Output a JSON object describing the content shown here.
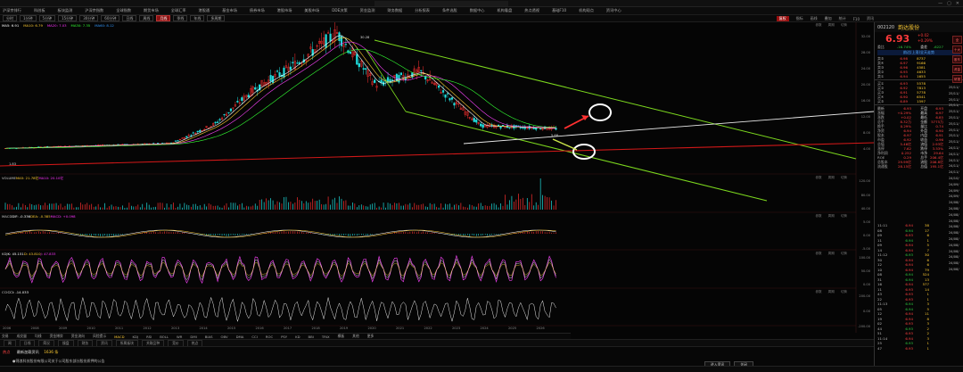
{
  "window": {
    "title_text": "",
    "controls": [
      "—",
      "▢",
      "✕"
    ]
  },
  "menu": {
    "items": [
      "沪深京排行",
      "科创板",
      "板块监测",
      "沪深京指数",
      "全球指数",
      "期货市场",
      "全球汇率",
      "港股通",
      "基金市场",
      "债券市场",
      "港股市场",
      "美股市场",
      "DDE决策",
      "资金监测",
      "财务数据",
      "分析报表",
      "条件选股",
      "数据中心",
      "机构看盘",
      "热点透视",
      "基础F10",
      "机构观点",
      "资讯中心"
    ]
  },
  "toolbar": {
    "periods": [
      "分时",
      "1分钟",
      "5分钟",
      "15分钟",
      "30分钟",
      "60分钟",
      "日线",
      "周线",
      "月线",
      "季线",
      "年线",
      "多周期"
    ],
    "active_period": "月线",
    "right_tools": [
      "复权",
      "指标",
      "画线",
      "叠加",
      "统计",
      "F10",
      "资讯"
    ]
  },
  "chart": {
    "main_legend": [
      "MA5: 6.91",
      "MA10: 6.79",
      "MA20: 7.03",
      "MA30: 7.35",
      "MA60: 8.12"
    ],
    "main_title": "",
    "y_ticks": [
      "32.00",
      "28.00",
      "24.00",
      "20.00",
      "16.00",
      "12.00",
      "8.00",
      "4.00"
    ],
    "peak_label": "30.28",
    "low_label": "1.83",
    "last_label": "5.68",
    "volume_legend": [
      "VOLUME",
      "MA5: 21.78亿",
      "MA10: 20.10亿"
    ],
    "volume_y": [
      "120.00",
      "80.00",
      "40.00"
    ],
    "macd_legend": [
      "MACD",
      "DIF: -0.336",
      "DEA: -0.385",
      "MACD: +0.098"
    ],
    "macd_y": [
      "5.00",
      "0.00",
      "-5.00"
    ],
    "kdj_legend": [
      "KDJ",
      "K: 45.151",
      "D: 43.810",
      "J: 47.833"
    ],
    "kdj_y": [
      "100.00",
      "50.00",
      "0.00"
    ],
    "cci_legend": [
      "CCI",
      "CCI: -14.033"
    ],
    "cci_y": [
      "200.00",
      "0.00",
      "-200.00"
    ],
    "panel_controls": [
      "参数",
      "周期",
      "切换"
    ],
    "x_years": [
      "2006",
      "2008",
      "2009",
      "2010",
      "2011",
      "2012",
      "2013",
      "2014",
      "2015",
      "2016",
      "2017",
      "2018",
      "2019",
      "2020",
      "2021",
      "2022",
      "2023",
      "2024",
      "2025",
      "2026"
    ]
  },
  "indicator_tabs": [
    "交易",
    "成交量",
    "均线",
    "资金博弈",
    "资金流向",
    "风险提示",
    "MACD",
    "KDJ",
    "RSI",
    "BOLL",
    "WR",
    "DMI",
    "BIAS",
    "OBV",
    "DMA",
    "CCI",
    "ROC",
    "PSY",
    "KD",
    "BBI",
    "TRIX",
    "模板",
    "其他",
    "更多"
  ],
  "active_indicator": "MACD",
  "status_tabs": [
    "闻",
    "日线",
    "简况",
    "操盘",
    "财务",
    "资讯",
    "所属板块",
    "关联品种",
    "竞价",
    "热点"
  ],
  "news": {
    "label": "热点",
    "headline": "最新加载资讯",
    "count": "1636 条",
    "line2": "●锦浪科技股份有限公司关于公司股东部分股份质押的公告",
    "btn1": "进入资讯",
    "btn2": "关闭"
  },
  "quote": {
    "code": "002120",
    "name": "韵达股份",
    "price": "6.93",
    "change": "+0.02",
    "change_pct": "+0.29%",
    "stats": [
      [
        "委比",
        "-16.74%",
        "委差",
        "-6227"
      ]
    ],
    "asks": [
      [
        "卖⑤",
        "6.98",
        "8737"
      ],
      [
        "卖④",
        "6.97",
        "9166"
      ],
      [
        "卖③",
        "6.96",
        "4581"
      ],
      [
        "卖②",
        "6.95",
        "4633"
      ],
      [
        "卖①",
        "6.94",
        "1655"
      ]
    ],
    "bids": [
      [
        "买①",
        "6.93",
        "5578"
      ],
      [
        "买②",
        "6.92",
        "7813"
      ],
      [
        "买③",
        "6.91",
        "5778"
      ],
      [
        "买④",
        "6.90",
        "6541"
      ],
      [
        "买⑤",
        "6.89",
        "1597"
      ]
    ],
    "details": [
      [
        "最新",
        "6.93",
        "开盘",
        "6.93"
      ],
      [
        "涨幅",
        "+0.29%",
        "最高",
        "6.97"
      ],
      [
        "涨跌",
        "+0.02",
        "最低",
        "6.85"
      ],
      [
        "总手",
        "8.32万",
        "金额",
        "5775万"
      ],
      [
        "换手",
        "0.29%",
        "量比",
        "0.74"
      ],
      [
        "净资",
        "6.94",
        "外盘",
        "6.90"
      ],
      [
        "股本",
        "6.97",
        "内盘",
        "6.91"
      ],
      [
        "市盈",
        "6.92",
        "收益",
        "0.96"
      ],
      [
        "总值",
        "5.46亿",
        "流值",
        "2.93亿"
      ],
      [
        "涨停",
        "7.62",
        "跌停",
        "3.53%"
      ],
      [
        "净利润",
        "0.252",
        "市净",
        "29.64"
      ],
      [
        "ROE",
        "0.29",
        "总手",
        "206.4亿"
      ],
      [
        "总股本",
        "29.99亿",
        "流股",
        "206.8亿"
      ],
      [
        "流通股",
        "28.15亿",
        "总值",
        "195.1亿"
      ]
    ],
    "blue_bar": "韵达(上涨)全天走势",
    "trades": [
      [
        "11:11",
        "6.94",
        "38"
      ],
      [
        "08",
        "6.94",
        "17"
      ],
      [
        "09",
        "6.93",
        "6"
      ],
      [
        "11",
        "6.94",
        "1"
      ],
      [
        "09",
        "6.94",
        "5"
      ],
      [
        "14",
        "6.94",
        "7"
      ],
      [
        "11:12",
        "6.93",
        "30"
      ],
      [
        "30",
        "6.94",
        "6"
      ],
      [
        "12",
        "6.94",
        "6"
      ],
      [
        "10",
        "6.94",
        "79"
      ],
      [
        "08",
        "6.94",
        "524"
      ],
      [
        "31",
        "6.94",
        "13"
      ],
      [
        "16",
        "6.94",
        "577"
      ],
      [
        "11",
        "6.93",
        "14"
      ],
      [
        "43",
        "6.93",
        "1"
      ],
      [
        "22",
        "6.93",
        "1"
      ],
      [
        "11:13",
        "6.94",
        "3"
      ],
      [
        "05",
        "6.94",
        "5"
      ],
      [
        "12",
        "6.94",
        "11"
      ],
      [
        "19",
        "6.94",
        "8"
      ],
      [
        "02",
        "6.93",
        "3"
      ],
      [
        "44",
        "6.93",
        "2"
      ],
      [
        "51",
        "6.93",
        "2"
      ],
      [
        "11:14",
        "6.94",
        "3"
      ],
      [
        "25",
        "6.93",
        "1"
      ],
      [
        "47",
        "6.93",
        "1"
      ]
    ],
    "cut_col": [
      "25/11/",
      "25/11/",
      "25/11/",
      "25/11/",
      "25/11/",
      "25/11/",
      "25/11/",
      "25/11/",
      "25/11/",
      "25/11/",
      "24/11/",
      "24/11/",
      "24/11/",
      "24/11/",
      "24/11/",
      "24/10/",
      "24/09/",
      "24/09/",
      "24/09/",
      "24/08/",
      "24/08/",
      "24/08/",
      "24/08/",
      "24/08/",
      "24/08/",
      "24/08/",
      "24/08/",
      "24/08/",
      "24/08/",
      "24/08/",
      "24/08/"
    ],
    "side_tabs": [
      "全",
      "十大",
      "股东",
      "资金",
      "研报"
    ]
  }
}
